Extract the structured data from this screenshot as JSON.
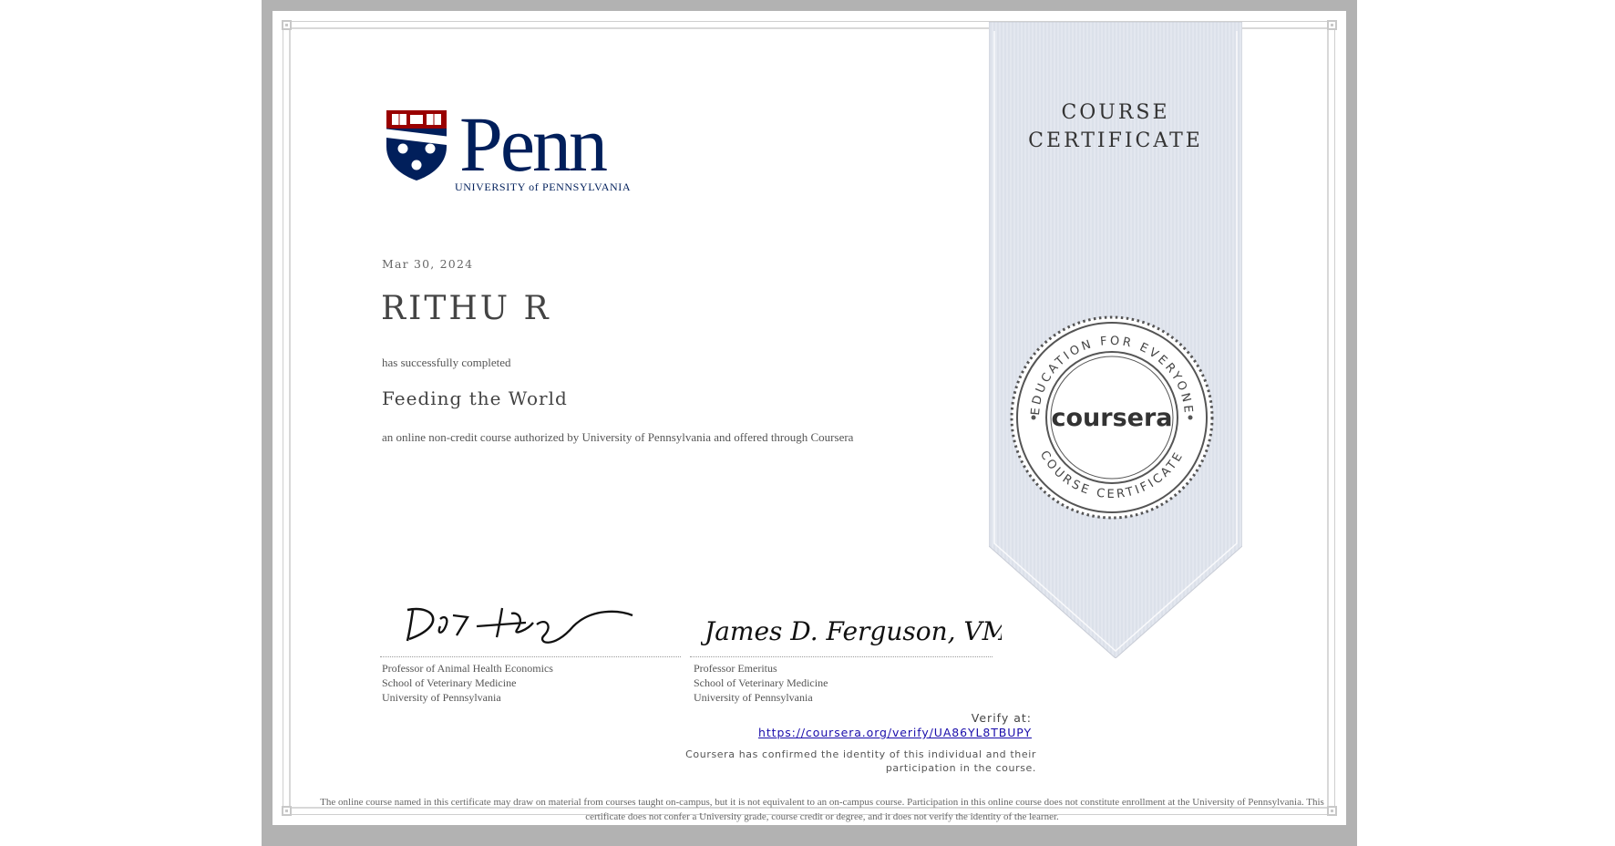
{
  "university": {
    "name": "Penn",
    "subtitle": "UNIVERSITY of PENNSYLVANIA"
  },
  "certificate": {
    "date": "Mar 30, 2024",
    "recipient": "RITHU R",
    "completed_text": "has successfully completed",
    "course": "Feeding the World",
    "description": "an online non-credit course authorized by University of Pennsylvania and offered through Coursera"
  },
  "ribbon": {
    "line1": "COURSE",
    "line2": "CERTIFICATE"
  },
  "seal": {
    "brand": "coursera",
    "top_text": "EDUCATION FOR EVERYONE",
    "bottom_text": "COURSE CERTIFICATE"
  },
  "signatures": [
    {
      "title": "Professor of Animal Health Economics",
      "school": "School of Veterinary Medicine",
      "institution": "University of Pennsylvania"
    },
    {
      "signature_text": "James D. Ferguson, VMD",
      "title": "Professor Emeritus",
      "school": "School of Veterinary Medicine",
      "institution": "University of Pennsylvania"
    }
  ],
  "verify": {
    "label": "Verify at:",
    "url": "https://coursera.org/verify/UA86YL8TBUPY",
    "confirmation": "Coursera has confirmed the identity of this individual and their participation in the course."
  },
  "disclaimer": "The online course named in this certificate may draw on material from courses taught on-campus, but it is not equivalent to an on-campus course. Participation in this online course does not constitute enrollment at the University of Pennsylvania. This certificate does not confer a University grade, course credit or degree, and it does not verify the identity of the learner.",
  "colors": {
    "penn_navy": "#011f5b",
    "penn_red": "#990000",
    "ribbon": "#e3e7ef",
    "seal": "#444444"
  }
}
